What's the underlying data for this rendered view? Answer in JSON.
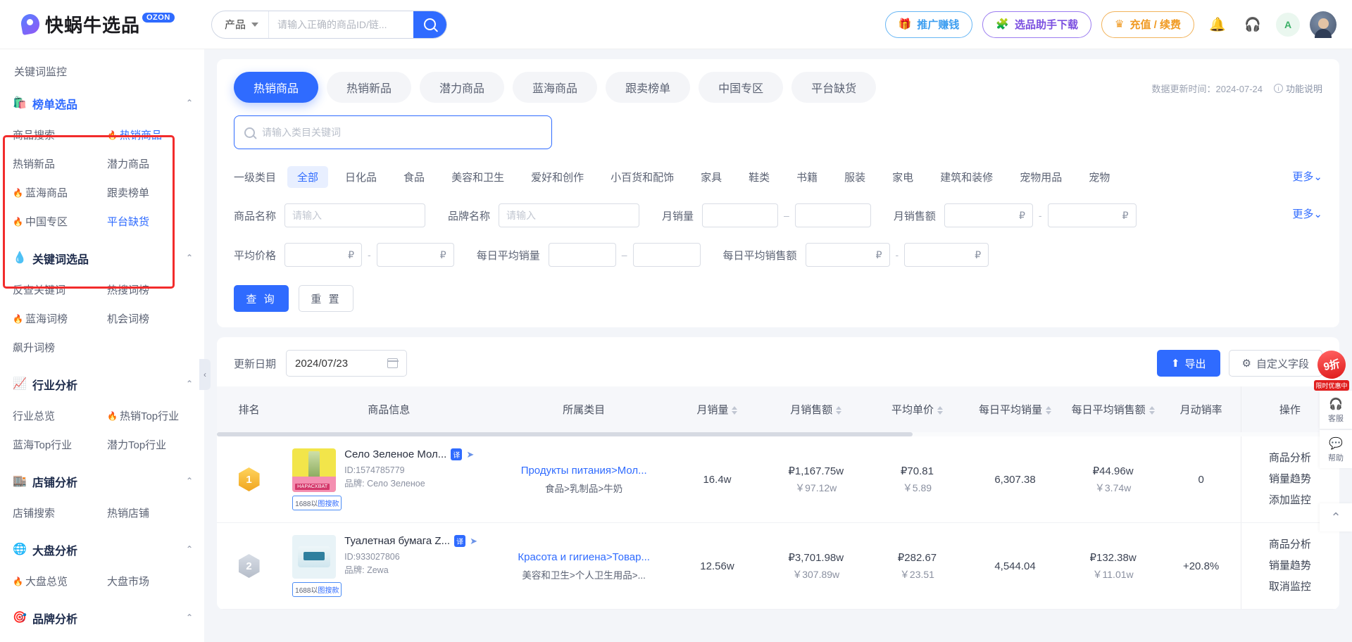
{
  "header": {
    "logo_text": "快蜗牛选品",
    "logo_badge": "OZON",
    "search_type": "产品",
    "search_placeholder": "请输入正确的商品ID/链...",
    "search_value": "",
    "search_icon": "search-icon",
    "buttons": [
      {
        "label": "推广赚钱",
        "icon": "gift-icon",
        "style": "blue"
      },
      {
        "label": "选品助手下载",
        "icon": "puzzle-icon",
        "style": "purple"
      },
      {
        "label": "充值 / 续费",
        "icon": "crown-icon",
        "style": "orange"
      }
    ],
    "icons": [
      {
        "name": "bell-icon",
        "glyph": "☒"
      },
      {
        "name": "headset-icon",
        "glyph": "☺"
      },
      {
        "name": "translate-icon",
        "glyph": "A"
      }
    ]
  },
  "sidebar": {
    "top_item": "关键词监控",
    "groups": [
      {
        "title": "榜单选品",
        "icon": "bag-icon",
        "active": true,
        "highlighted": true,
        "links": [
          {
            "label": "商品搜索",
            "hot": false,
            "active": false
          },
          {
            "label": "热销商品",
            "hot": true,
            "active": true
          },
          {
            "label": "热销新品",
            "hot": false,
            "active": false
          },
          {
            "label": "潜力商品",
            "hot": false,
            "active": false
          },
          {
            "label": "蓝海商品",
            "hot": true,
            "active": false
          },
          {
            "label": "跟卖榜单",
            "hot": false,
            "active": false
          },
          {
            "label": "中国专区",
            "hot": true,
            "active": false
          },
          {
            "label": "平台缺货",
            "hot": false,
            "active": true
          }
        ]
      },
      {
        "title": "关键词选品",
        "icon": "hot-drop-icon",
        "links": [
          {
            "label": "反查关键词",
            "hot": false,
            "active": false
          },
          {
            "label": "热搜词榜",
            "hot": false,
            "active": false
          },
          {
            "label": "蓝海词榜",
            "hot": true,
            "active": false
          },
          {
            "label": "机会词榜",
            "hot": false,
            "active": false
          },
          {
            "label": "飙升词榜",
            "hot": false,
            "active": false
          }
        ]
      },
      {
        "title": "行业分析",
        "icon": "chart-icon",
        "links": [
          {
            "label": "行业总览",
            "hot": false,
            "active": false
          },
          {
            "label": "热销Top行业",
            "hot": true,
            "active": false
          },
          {
            "label": "蓝海Top行业",
            "hot": false,
            "active": false
          },
          {
            "label": "潜力Top行业",
            "hot": false,
            "active": false
          }
        ]
      },
      {
        "title": "店铺分析",
        "icon": "store-icon",
        "links": [
          {
            "label": "店铺搜索",
            "hot": false,
            "active": false
          },
          {
            "label": "热销店铺",
            "hot": false,
            "active": false
          }
        ]
      },
      {
        "title": "大盘分析",
        "icon": "globe-icon",
        "links": [
          {
            "label": "大盘总览",
            "hot": true,
            "active": false
          },
          {
            "label": "大盘市场",
            "hot": false,
            "active": false
          }
        ]
      },
      {
        "title": "品牌分析",
        "icon": "brand-icon",
        "links": []
      }
    ],
    "collapse_icon": "chevron-left-icon"
  },
  "filters": {
    "tabs": [
      {
        "label": "热销商品",
        "active": true
      },
      {
        "label": "热销新品",
        "active": false
      },
      {
        "label": "潜力商品",
        "active": false
      },
      {
        "label": "蓝海商品",
        "active": false
      },
      {
        "label": "跟卖榜单",
        "active": false
      },
      {
        "label": "中国专区",
        "active": false
      },
      {
        "label": "平台缺货",
        "active": false
      }
    ],
    "update_time": "数据更新时间：2024-07-24",
    "func_desc": "功能说明",
    "keyword_placeholder": "请输入类目关键词",
    "keyword_value": "",
    "category_label": "一级类目",
    "categories": [
      {
        "label": "全部",
        "active": true
      },
      {
        "label": "日化品",
        "active": false
      },
      {
        "label": "食品",
        "active": false
      },
      {
        "label": "美容和卫生",
        "active": false
      },
      {
        "label": "爱好和创作",
        "active": false
      },
      {
        "label": "小百货和配饰",
        "active": false
      },
      {
        "label": "家具",
        "active": false
      },
      {
        "label": "鞋类",
        "active": false
      },
      {
        "label": "书籍",
        "active": false
      },
      {
        "label": "服装",
        "active": false
      },
      {
        "label": "家电",
        "active": false
      },
      {
        "label": "建筑和装修",
        "active": false
      },
      {
        "label": "宠物用品",
        "active": false
      },
      {
        "label": "宠物",
        "active": false
      }
    ],
    "more_label": "更多",
    "fields": {
      "product_name_label": "商品名称",
      "product_name_placeholder": "请输入",
      "product_name_value": "",
      "brand_name_label": "品牌名称",
      "brand_name_placeholder": "请输入",
      "brand_name_value": "",
      "monthly_sales_label": "月销量",
      "monthly_sales_min": "",
      "monthly_sales_max": "",
      "monthly_revenue_label": "月销售额",
      "monthly_revenue_min": "",
      "monthly_revenue_max": "",
      "avg_price_label": "平均价格",
      "avg_price_min": "",
      "avg_price_max": "",
      "daily_avg_sales_label": "每日平均销量",
      "daily_avg_sales_min": "",
      "daily_avg_sales_max": "",
      "daily_avg_revenue_label": "每日平均销售额",
      "daily_avg_revenue_min": "",
      "daily_avg_revenue_max": "",
      "currency_symbol": "₽"
    },
    "submit_label": "查 询",
    "reset_label": "重 置"
  },
  "table": {
    "date_label": "更新日期",
    "date_value": "2024/07/23",
    "export_label": "导出",
    "export_icon": "cloud-upload-icon",
    "custom_fields_label": "自定义字段",
    "custom_fields_icon": "gear-icon",
    "columns": [
      {
        "label": "排名",
        "sortable": false
      },
      {
        "label": "商品信息",
        "sortable": false
      },
      {
        "label": "所属类目",
        "sortable": false
      },
      {
        "label": "月销量",
        "sortable": true
      },
      {
        "label": "月销售额",
        "sortable": true
      },
      {
        "label": "平均单价",
        "sortable": true
      },
      {
        "label": "每日平均销量",
        "sortable": true
      },
      {
        "label": "每日平均销售额",
        "sortable": true
      },
      {
        "label": "月动销率",
        "sortable": false
      },
      {
        "label": "操作",
        "sortable": false
      }
    ],
    "rows": [
      {
        "rank": "1",
        "title": "Село Зеленое Мол...",
        "translate_badge": "译",
        "id": "ID:1574785779",
        "brand": "品牌: Село Зеленое",
        "tag_1688_prefix": "1688以",
        "tag_1688_link": "图搜款",
        "category_main": "Продукты питания>Мол...",
        "category_sub": "食品>乳制品>牛奶",
        "monthly_sales": "16.4w",
        "monthly_revenue_rub": "₽1,167.75w",
        "monthly_revenue_cny": "￥97.12w",
        "avg_price_rub": "₽70.81",
        "avg_price_cny": "￥5.89",
        "daily_avg_sales": "6,307.38",
        "daily_avg_revenue_rub": "₽44.96w",
        "daily_avg_revenue_cny": "￥3.74w",
        "turnover_rate": "0",
        "actions": [
          "商品分析",
          "销量趋势",
          "添加监控"
        ]
      },
      {
        "rank": "2",
        "title": "Туалетная бумага Z...",
        "translate_badge": "译",
        "id": "ID:933027806",
        "brand": "品牌: Zewa",
        "tag_1688_prefix": "1688以",
        "tag_1688_link": "图搜款",
        "category_main": "Красота и гигиена>Товар...",
        "category_sub": "美容和卫生>个人卫生用品>...",
        "monthly_sales": "12.56w",
        "monthly_revenue_rub": "₽3,701.98w",
        "monthly_revenue_cny": "￥307.89w",
        "avg_price_rub": "₽282.67",
        "avg_price_cny": "￥23.51",
        "daily_avg_sales": "4,544.04",
        "daily_avg_revenue_rub": "₽132.38w",
        "daily_avg_revenue_cny": "￥11.01w",
        "turnover_rate": "+20.8%",
        "actions": [
          "商品分析",
          "销量趋势",
          "取消监控"
        ]
      }
    ]
  },
  "rail": {
    "promo_discount": "9折",
    "promo_label": "限时优惠中",
    "items": [
      {
        "label": "客服",
        "icon": "headset-icon",
        "glyph": "☺"
      },
      {
        "label": "帮助",
        "icon": "question-icon",
        "glyph": "?"
      }
    ],
    "back_to_top_icon": "chevron-up-icon"
  }
}
